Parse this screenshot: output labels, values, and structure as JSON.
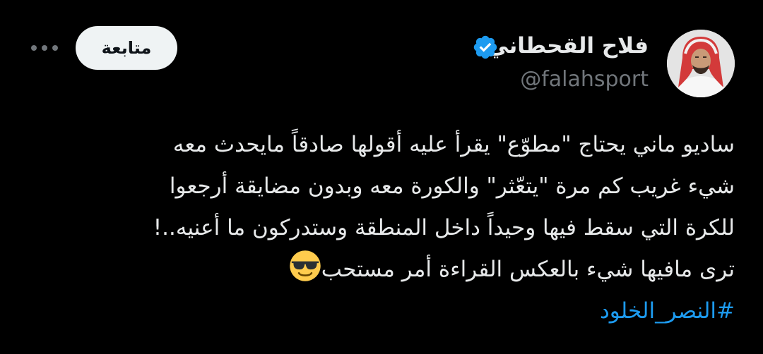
{
  "user": {
    "display_name": "فلاح القحطاني",
    "handle": "@falahsport",
    "verified_icon": "verified-badge-icon",
    "avatar_icon": "avatar-photo"
  },
  "actions": {
    "follow_label": "متابعة",
    "more_icon": "more-options-icon"
  },
  "tweet": {
    "lines": [
      "ساديو ماني يحتاج \"مطوّع\" يقرأ عليه أقولها صادقاً مايحدث معه",
      "شيء غريب كم مرة \"يتعّثر\" والكورة معه وبدون مضايقة أرجعوا",
      "للكرة التي سقط فيها وحيداً داخل المنطقة وستدركون ما أعنيه..!",
      "ترى مافيها شيء بالعكس القراءة أمر مستحب"
    ],
    "emoji": "smiling-face-with-sunglasses",
    "hashtag": "#النصر_الخلود"
  },
  "colors": {
    "background": "#000000",
    "text": "#e7e9ea",
    "secondary_text": "#71767b",
    "accent": "#1d9bf0",
    "follow_bg": "#eff3f4"
  }
}
